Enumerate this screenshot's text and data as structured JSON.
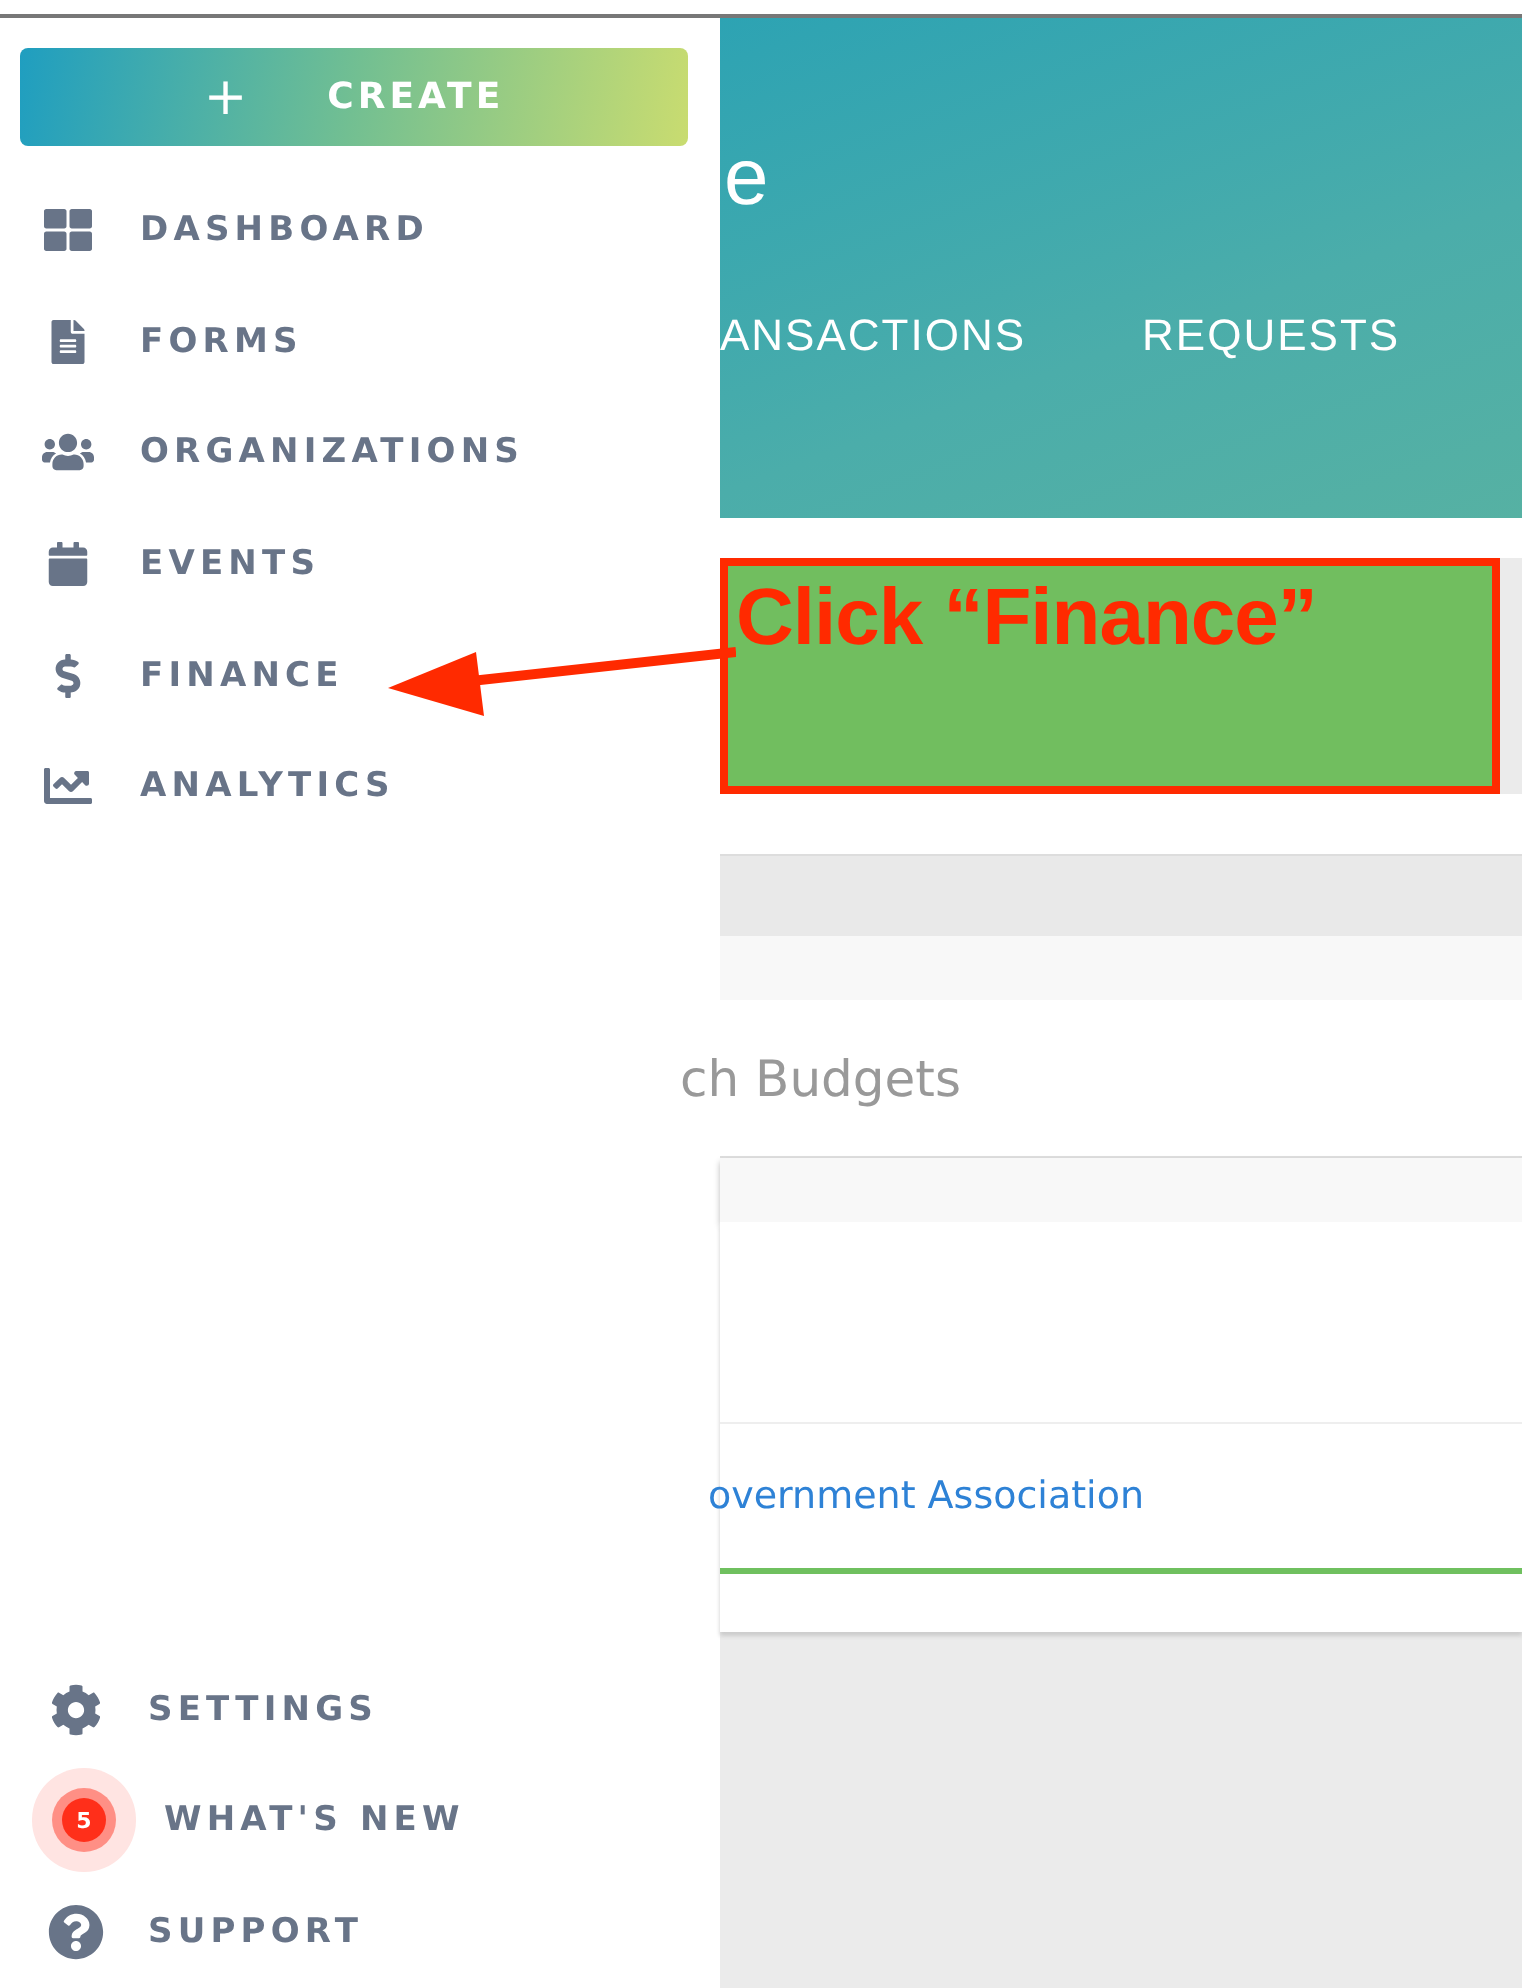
{
  "sidebar": {
    "create_button": {
      "icon": "+",
      "label": "CREATE"
    },
    "items": [
      {
        "kind": "dashboard",
        "label": "DASHBOARD"
      },
      {
        "kind": "forms",
        "label": "FORMS"
      },
      {
        "kind": "organizations",
        "label": "ORGANIZATIONS"
      },
      {
        "kind": "events",
        "label": "EVENTS"
      },
      {
        "kind": "finance",
        "label": "FINANCE"
      },
      {
        "kind": "analytics",
        "label": "ANALYTICS"
      }
    ],
    "footer_items": [
      {
        "kind": "settings",
        "label": "SETTINGS"
      },
      {
        "kind": "whats_new",
        "label": "WHAT'S NEW",
        "badge": "5"
      },
      {
        "kind": "support",
        "label": "SUPPORT"
      }
    ]
  },
  "header": {
    "title": "e",
    "tabs": [
      {
        "label": "ANSACTIONS"
      },
      {
        "label": "REQUESTS"
      }
    ]
  },
  "annotation": {
    "text": "Click “Finance”"
  },
  "budgets": {
    "title": "ch Budgets"
  },
  "organization_link": "overnment Association"
}
